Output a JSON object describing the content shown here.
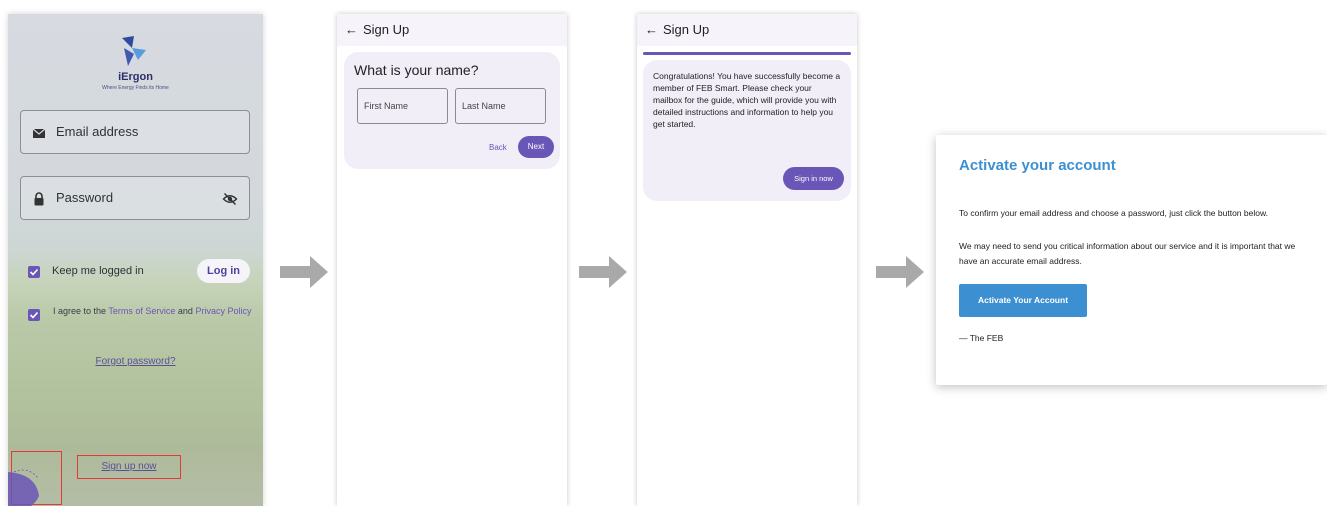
{
  "login": {
    "brand": "iErgon",
    "tagline": "Where Energy Finds its Home",
    "email_label": "Email address",
    "password_label": "Password",
    "keep_logged_in": "Keep me logged in",
    "login_button": "Log in",
    "agree_prefix": "I agree to the ",
    "terms_link": "Terms of Service",
    "agree_and": " and ",
    "privacy_link": "Privacy Policy",
    "forgot_password": "Forgot password?",
    "sign_up": "Sign up now",
    "icons": [
      "envelope-icon",
      "lock-icon",
      "eye-off-icon",
      "checkbox-checked-icon"
    ],
    "accent": "#6a56b6"
  },
  "signup_name": {
    "title": "Sign Up",
    "question": "What is your name?",
    "first_name_placeholder": "First Name",
    "last_name_placeholder": "Last Name",
    "back": "Back",
    "next": "Next"
  },
  "signup_done": {
    "title": "Sign Up",
    "message": "Congratulations! You have successfully become a member of FEB Smart. Please check your mailbox for the guide, which will provide you with detailed instructions and information to help you get started.",
    "sign_in": "Sign in now"
  },
  "email": {
    "title": "Activate your account",
    "p1": "To confirm your email address and choose a password, just click the button below.",
    "p2": "We may need to send you critical information about our service and it is important that we have an accurate email address.",
    "button": "Activate Your Account",
    "signature": "— The FEB",
    "accent": "#3c8fd0"
  }
}
